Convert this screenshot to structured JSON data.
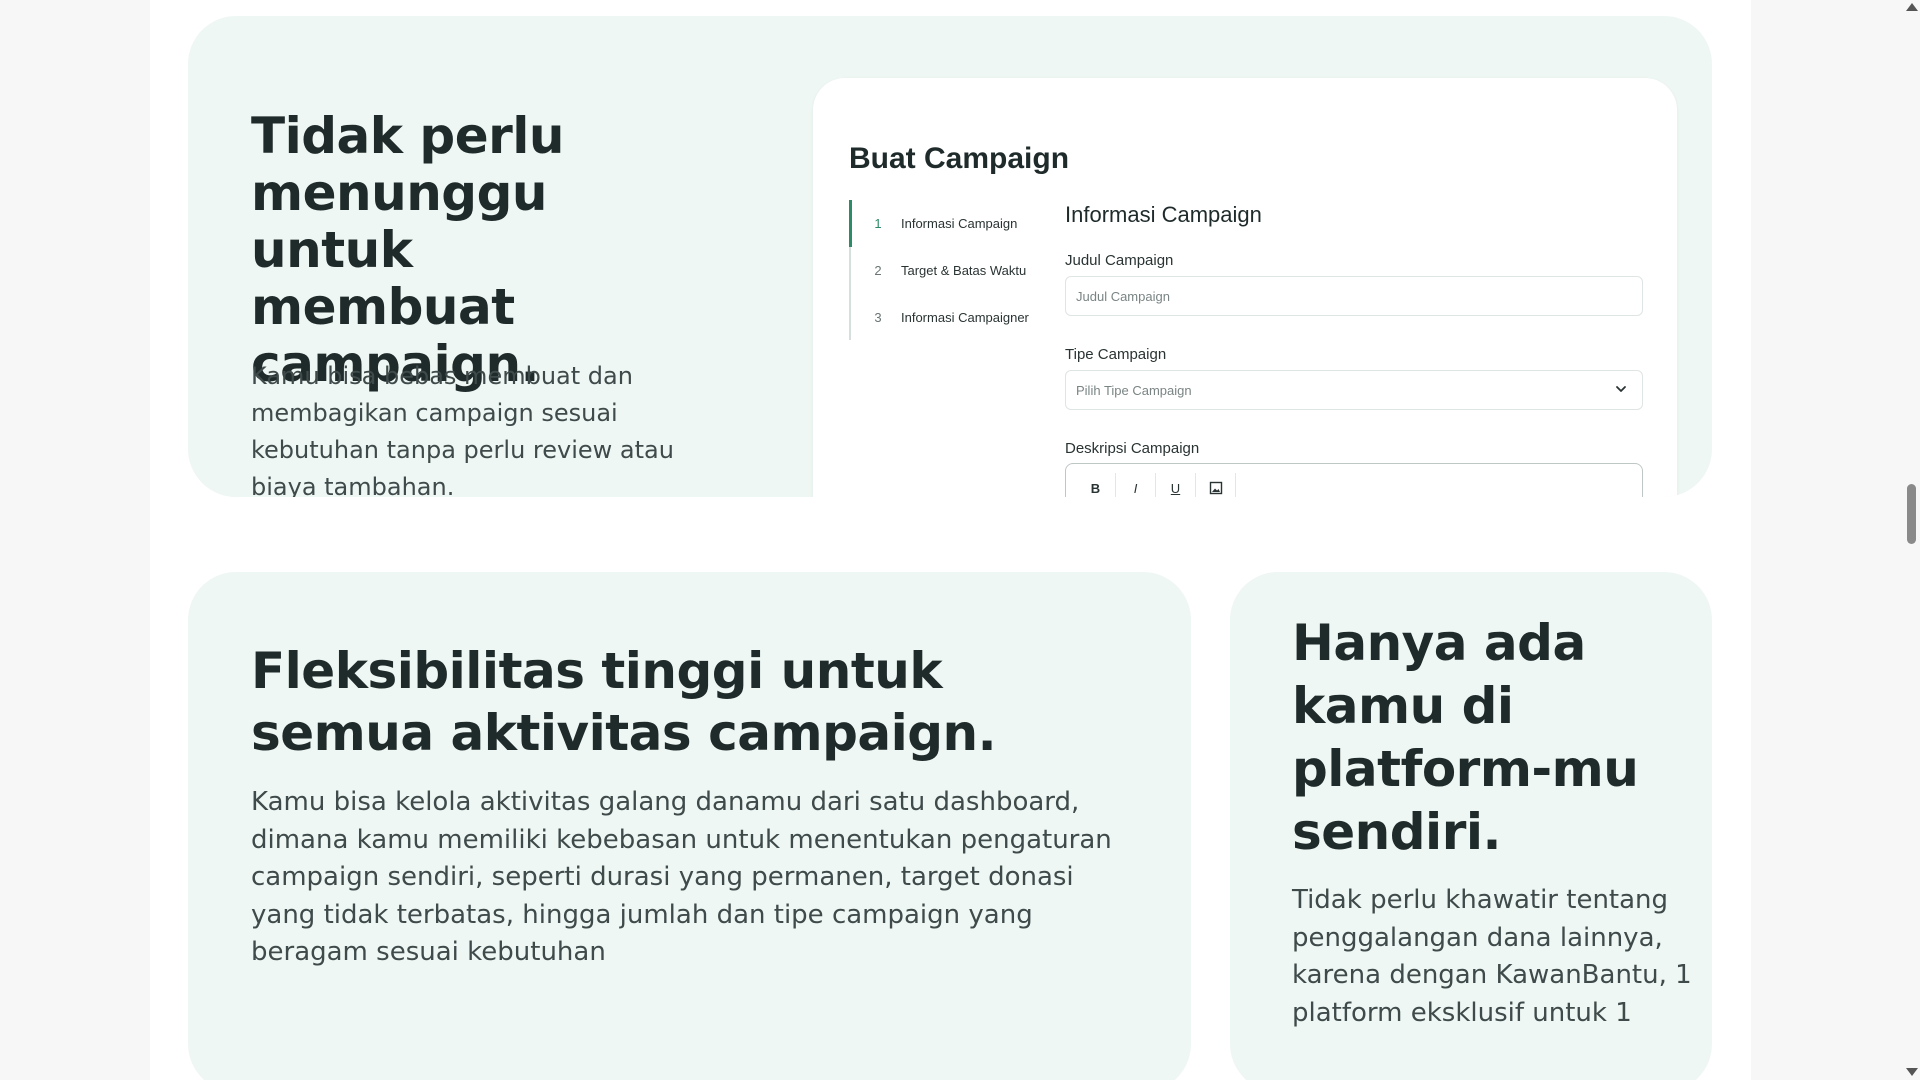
{
  "section_top": {
    "heading": "Tidak perlu menunggu untuk membuat campaign.",
    "body": "Kamu bisa bebas membuat dan membagikan campaign sesuai kebutuhan tanpa perlu review atau biaya tambahan.",
    "mockup": {
      "title": "Buat Campaign",
      "steps": [
        {
          "num": "1",
          "label": "Informasi Campaign"
        },
        {
          "num": "2",
          "label": "Target & Batas Waktu"
        },
        {
          "num": "3",
          "label": "Informasi Campaigner"
        }
      ],
      "form_title": "Informasi Campaign",
      "judul_label": "Judul Campaign",
      "judul_placeholder": "Judul Campaign",
      "tipe_label": "Tipe Campaign",
      "tipe_value": "Pilih Tipe Campaign",
      "deskripsi_label": "Deskripsi Campaign",
      "toolbar": {
        "bold": "B",
        "italic": "I",
        "underline": "U"
      }
    }
  },
  "section_left": {
    "heading": "Fleksibilitas tinggi untuk semua aktivitas campaign.",
    "body": "Kamu bisa kelola aktivitas galang danamu dari satu dashboard, dimana kamu memiliki kebebasan untuk menentukan pengaturan campaign sendiri, seperti durasi yang permanen, target donasi yang tidak terbatas, hingga jumlah dan tipe campaign yang beragam sesuai kebutuhan"
  },
  "section_right": {
    "heading": "Hanya ada kamu di platform-mu sendiri.",
    "body": "Tidak perlu khawatir tentang penggalangan dana lainnya, karena dengan KawanBantu, 1 platform eksklusif untuk 1"
  },
  "colors": {
    "card_bg": "#eef7f3",
    "accent": "#2e8b67",
    "heading": "#1f2a2a"
  }
}
